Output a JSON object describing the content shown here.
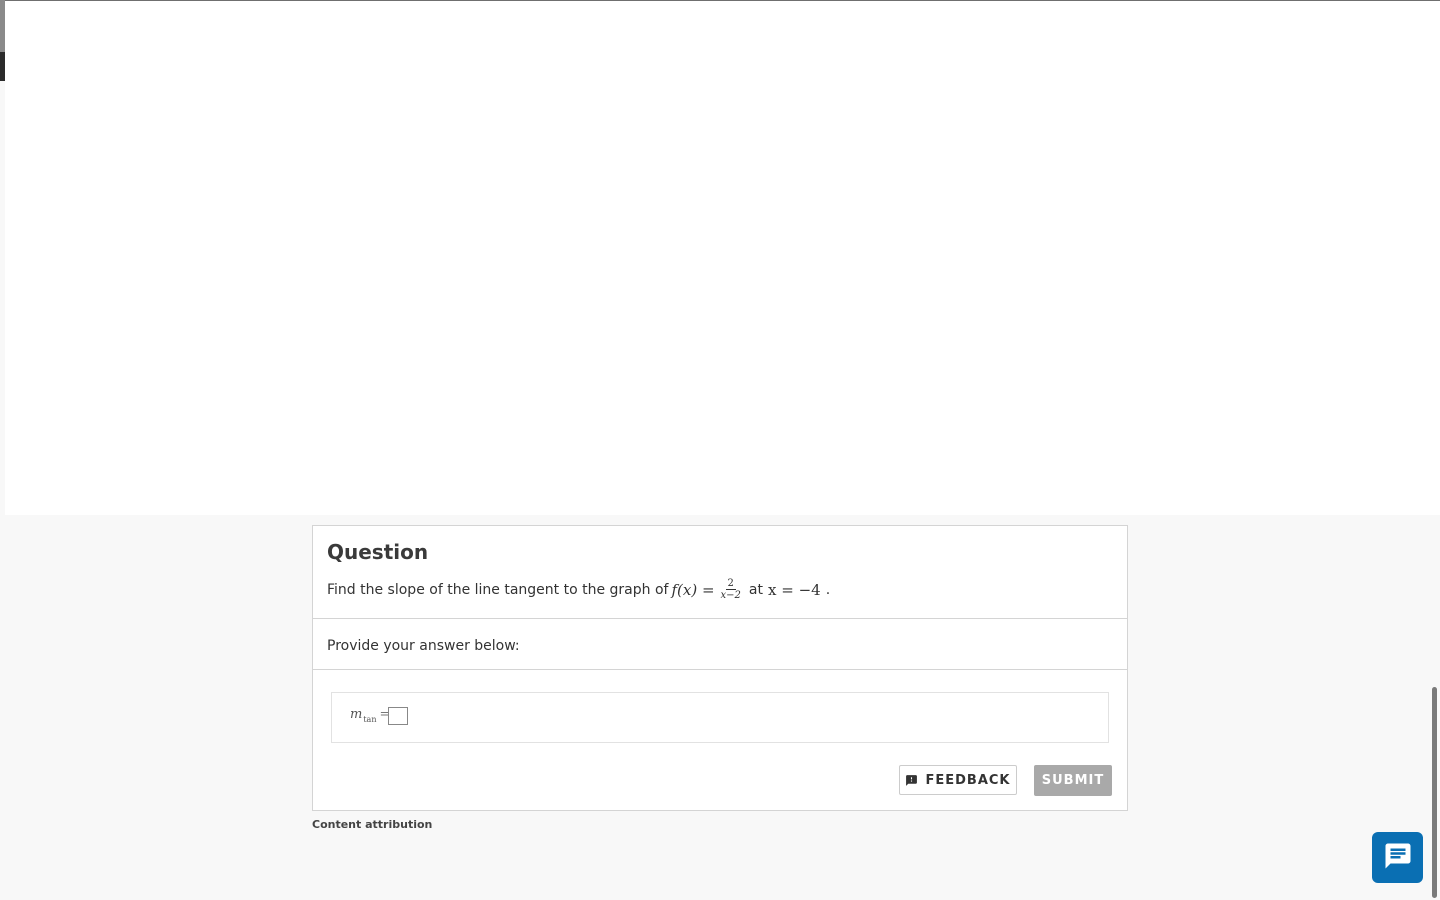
{
  "question": {
    "title": "Question",
    "prompt_prefix": "Find the slope of the line tangent to the graph of",
    "function_lhs": "f(x) =",
    "fraction_numerator": "2",
    "fraction_denominator": "x−2",
    "at_word": "at",
    "point": "x = −4",
    "period": "."
  },
  "answer_section": {
    "instruction": "Provide your answer below:",
    "variable": "m",
    "variable_subscript": "tan",
    "equals": "=",
    "input_value": ""
  },
  "buttons": {
    "feedback_label": "FEEDBACK",
    "submit_label": "SUBMIT"
  },
  "footer": {
    "attribution": "Content attribution"
  },
  "icons": {
    "feedback": "feedback-icon",
    "chat": "chat-icon"
  },
  "colors": {
    "chat_button": "#0a6fb3",
    "submit_disabled": "#a9a9a9"
  }
}
